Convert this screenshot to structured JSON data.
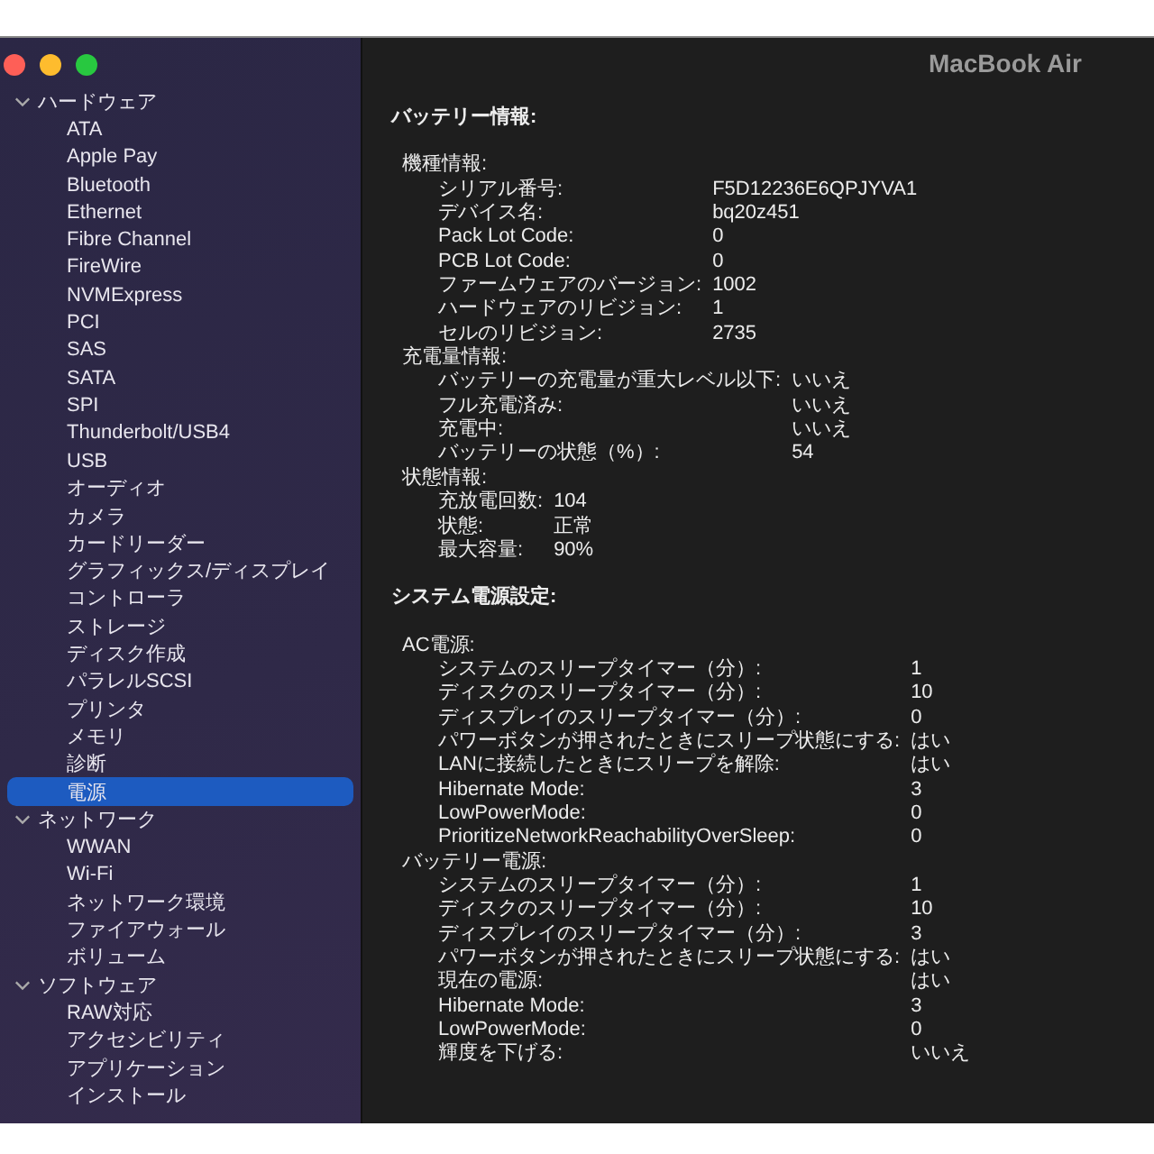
{
  "window": {
    "title": "MacBook Air"
  },
  "sidebar": {
    "sections": [
      {
        "label": "ハードウェア",
        "expanded": true,
        "items": [
          {
            "label": "ATA",
            "selected": false
          },
          {
            "label": "Apple Pay",
            "selected": false
          },
          {
            "label": "Bluetooth",
            "selected": false
          },
          {
            "label": "Ethernet",
            "selected": false
          },
          {
            "label": "Fibre Channel",
            "selected": false
          },
          {
            "label": "FireWire",
            "selected": false
          },
          {
            "label": "NVMExpress",
            "selected": false
          },
          {
            "label": "PCI",
            "selected": false
          },
          {
            "label": "SAS",
            "selected": false
          },
          {
            "label": "SATA",
            "selected": false
          },
          {
            "label": "SPI",
            "selected": false
          },
          {
            "label": "Thunderbolt/USB4",
            "selected": false
          },
          {
            "label": "USB",
            "selected": false
          },
          {
            "label": "オーディオ",
            "selected": false
          },
          {
            "label": "カメラ",
            "selected": false
          },
          {
            "label": "カードリーダー",
            "selected": false
          },
          {
            "label": "グラフィックス/ディスプレイ",
            "selected": false
          },
          {
            "label": "コントローラ",
            "selected": false
          },
          {
            "label": "ストレージ",
            "selected": false
          },
          {
            "label": "ディスク作成",
            "selected": false
          },
          {
            "label": "パラレルSCSI",
            "selected": false
          },
          {
            "label": "プリンタ",
            "selected": false
          },
          {
            "label": "メモリ",
            "selected": false
          },
          {
            "label": "診断",
            "selected": false
          },
          {
            "label": "電源",
            "selected": true
          }
        ]
      },
      {
        "label": "ネットワーク",
        "expanded": true,
        "items": [
          {
            "label": "WWAN",
            "selected": false
          },
          {
            "label": "Wi-Fi",
            "selected": false
          },
          {
            "label": "ネットワーク環境",
            "selected": false
          },
          {
            "label": "ファイアウォール",
            "selected": false
          },
          {
            "label": "ボリューム",
            "selected": false
          }
        ]
      },
      {
        "label": "ソフトウェア",
        "expanded": true,
        "items": [
          {
            "label": "RAW対応",
            "selected": false
          },
          {
            "label": "アクセシビリティ",
            "selected": false
          },
          {
            "label": "アプリケーション",
            "selected": false
          },
          {
            "label": "インストール",
            "selected": false
          }
        ]
      }
    ]
  },
  "detail": {
    "sections": [
      {
        "title": "バッテリー情報:",
        "groups": [
          {
            "title": "機種情報:",
            "rows": [
              {
                "label": "シリアル番号:",
                "value": "F5D12236E6QPJYVA1"
              },
              {
                "label": "デバイス名:",
                "value": "bq20z451"
              },
              {
                "label": "Pack Lot Code:",
                "value": "0"
              },
              {
                "label": "PCB Lot Code:",
                "value": "0"
              },
              {
                "label": "ファームウェアのバージョン:",
                "value": "1002"
              },
              {
                "label": "ハードウェアのリビジョン:",
                "value": "1"
              },
              {
                "label": "セルのリビジョン:",
                "value": "2735"
              }
            ]
          },
          {
            "title": "充電量情報:",
            "rows": [
              {
                "label": "バッテリーの充電量が重大レベル以下:",
                "value": "いいえ"
              },
              {
                "label": "フル充電済み:",
                "value": "いいえ"
              },
              {
                "label": "充電中:",
                "value": "いいえ"
              },
              {
                "label": "バッテリーの状態（%）:",
                "value": "54"
              }
            ]
          },
          {
            "title": "状態情報:",
            "rows": [
              {
                "label": "充放電回数:",
                "value": "104"
              },
              {
                "label": "状態:",
                "value": "正常"
              },
              {
                "label": "最大容量:",
                "value": "90%"
              }
            ]
          }
        ]
      },
      {
        "title": "システム電源設定:",
        "groups": [
          {
            "title": "AC電源:",
            "rows": [
              {
                "label": "システムのスリープタイマー（分）:",
                "value": "1"
              },
              {
                "label": "ディスクのスリープタイマー（分）:",
                "value": "10"
              },
              {
                "label": "ディスプレイのスリープタイマー（分）:",
                "value": "0"
              },
              {
                "label": "パワーボタンが押されたときにスリープ状態にする:",
                "value": "はい"
              },
              {
                "label": "LANに接続したときにスリープを解除:",
                "value": "はい"
              },
              {
                "label": "Hibernate Mode:",
                "value": "3"
              },
              {
                "label": "LowPowerMode:",
                "value": "0"
              },
              {
                "label": "PrioritizeNetworkReachabilityOverSleep:",
                "value": "0"
              }
            ]
          },
          {
            "title": "バッテリー電源:",
            "rows": [
              {
                "label": "システムのスリープタイマー（分）:",
                "value": "1"
              },
              {
                "label": "ディスクのスリープタイマー（分）:",
                "value": "10"
              },
              {
                "label": "ディスプレイのスリープタイマー（分）:",
                "value": "3"
              },
              {
                "label": "パワーボタンが押されたときにスリープ状態にする:",
                "value": "はい"
              },
              {
                "label": "現在の電源:",
                "value": "はい"
              },
              {
                "label": "Hibernate Mode:",
                "value": "3"
              },
              {
                "label": "LowPowerMode:",
                "value": "0"
              },
              {
                "label": "輝度を下げる:",
                "value": "いいえ"
              }
            ]
          }
        ]
      }
    ]
  }
}
